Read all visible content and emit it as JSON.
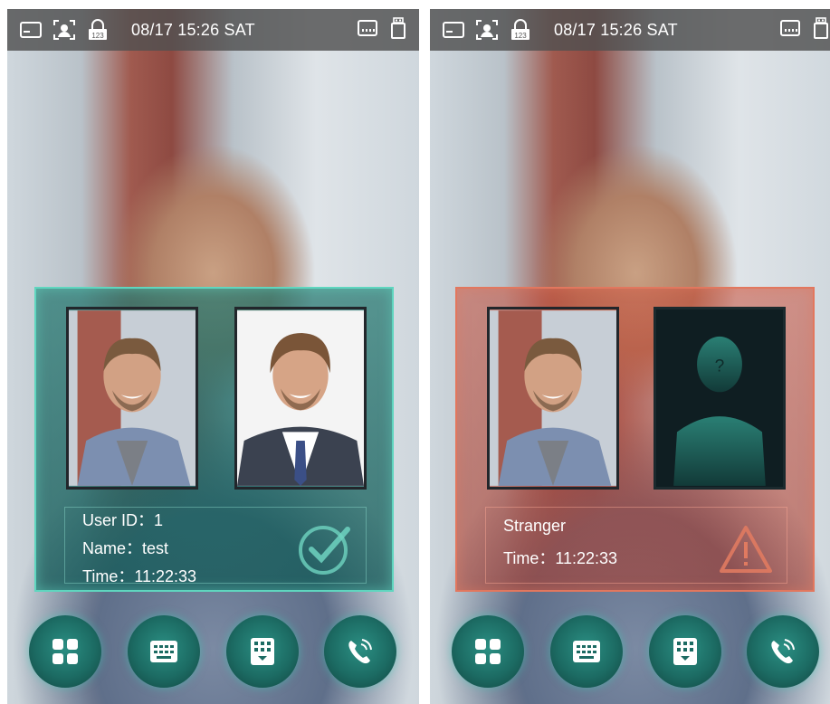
{
  "status_bar": {
    "icons": [
      "card-icon",
      "face-scan-icon",
      "password-lock-icon"
    ],
    "lock_digits": "123",
    "datetime": "08/17 15:26  SAT",
    "right_icons": [
      "ethernet-icon",
      "usb-icon"
    ]
  },
  "screens": [
    {
      "state": "verified",
      "accent": "#5fd6bf",
      "info": {
        "line1": "User ID：1",
        "line2": "Name：test",
        "line3": "Time：11:22:33"
      },
      "badge_icon": "check-circle-icon"
    },
    {
      "state": "stranger",
      "accent": "#e2775e",
      "unknown_mark": "?",
      "info": {
        "line1": "Stranger",
        "line2": "Time：11:22:33"
      },
      "badge_icon": "warning-triangle-icon"
    }
  ],
  "bottom_buttons": [
    "menu-icon",
    "keyboard-icon",
    "keypad-icon",
    "call-icon"
  ]
}
